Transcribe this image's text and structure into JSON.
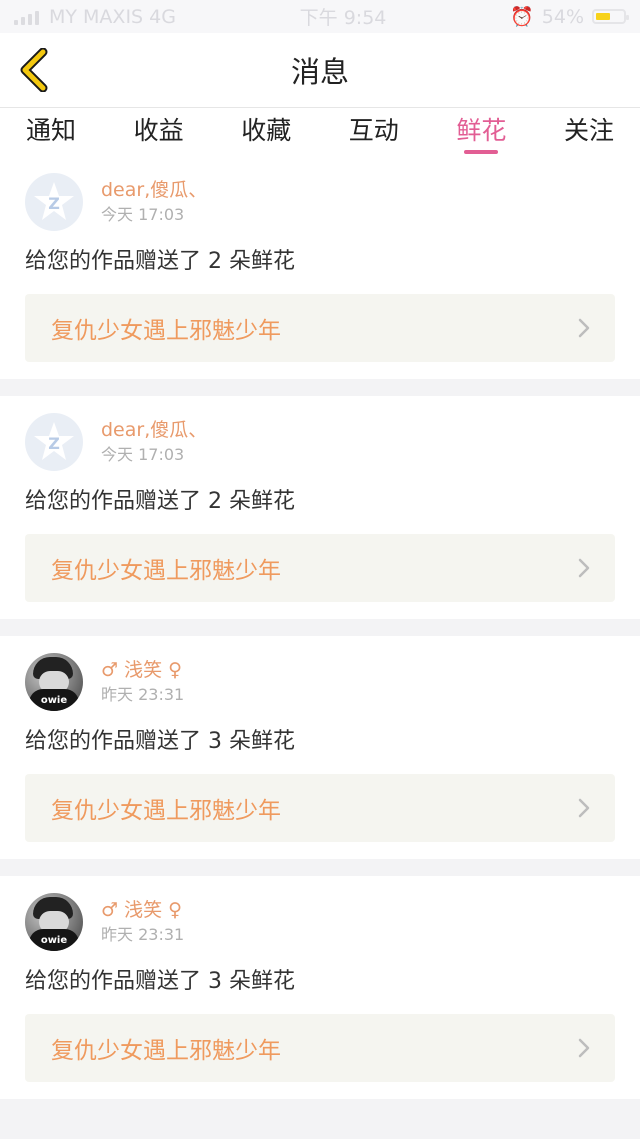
{
  "status_bar": {
    "carrier": "MY MAXIS 4G",
    "time": "下午 9:54",
    "battery": "54%"
  },
  "header": {
    "title": "消息"
  },
  "tabs": [
    {
      "label": "通知",
      "active": false
    },
    {
      "label": "收益",
      "active": false
    },
    {
      "label": "收藏",
      "active": false
    },
    {
      "label": "互动",
      "active": false
    },
    {
      "label": "鲜花",
      "active": true
    },
    {
      "label": "关注",
      "active": false
    }
  ],
  "messages": [
    {
      "username": "dear,傻瓜、",
      "time": "今天 17:03",
      "text": "给您的作品赠送了 2 朵鲜花",
      "work_title": "复仇少女遇上邪魅少年",
      "avatar": "qq-default-avatar"
    },
    {
      "username": "dear,傻瓜、",
      "time": "今天 17:03",
      "text": "给您的作品赠送了 2 朵鲜花",
      "work_title": "复仇少女遇上邪魅少年",
      "avatar": "qq-default-avatar"
    },
    {
      "username": "♂ 浅笑 ♀",
      "time": "昨天 23:31",
      "text": "给您的作品赠送了 3 朵鲜花",
      "work_title": "复仇少女遇上邪魅少年",
      "avatar": "photo-avatar"
    },
    {
      "username": "♂ 浅笑 ♀",
      "time": "昨天 23:31",
      "text": "给您的作品赠送了 3 朵鲜花",
      "work_title": "复仇少女遇上邪魅少年",
      "avatar": "photo-avatar"
    }
  ],
  "colors": {
    "accent_pink": "#e25e94",
    "username_orange": "#e89a6c",
    "work_title_orange": "#ef9a5e",
    "back_icon_yellow": "#f3c80f"
  }
}
